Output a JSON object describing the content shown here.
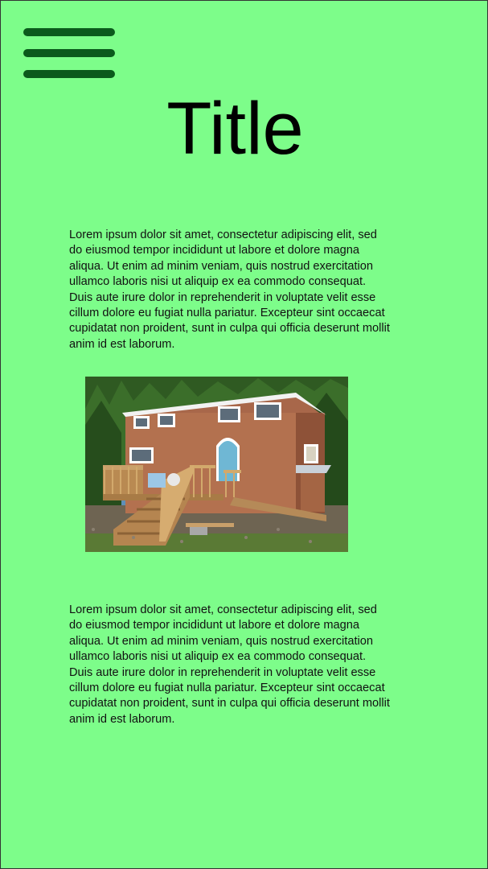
{
  "menu": {
    "icon": "hamburger-menu-icon",
    "color": "#0b5a1c"
  },
  "header": {
    "title": "Title"
  },
  "content": {
    "paragraph_1": "Lorem ipsum dolor sit amet, consectetur adipiscing elit, sed do eiusmod tempor incididunt ut labore et dolore magna aliqua. Ut enim ad minim veniam, quis nostrud exercitation ullamco laboris nisi ut aliquip ex ea commodo consequat. Duis aute irure dolor in reprehenderit in voluptate velit esse cillum dolore eu fugiat nulla pariatur. Excepteur sint occaecat cupidatat non proident, sunt in culpa qui officia deserunt mollit anim id est laborum.",
    "paragraph_2": "Lorem ipsum dolor sit amet, consectetur adipiscing elit, sed do eiusmod tempor incididunt ut labore et dolore magna aliqua. Ut enim ad minim veniam, quis nostrud exercitation ullamco laboris nisi ut aliquip ex ea commodo consequat. Duis aute irure dolor in reprehenderit in voluptate velit esse cillum dolore eu fugiat nulla pariatur. Excepteur sint occaecat cupidatat non proident, sunt in culpa qui officia deserunt mollit anim id est laborum."
  },
  "image": {
    "subject": "tiny-house-photo"
  },
  "colors": {
    "background": "#7dfd8a",
    "border": "#333333",
    "text": "#111111"
  }
}
